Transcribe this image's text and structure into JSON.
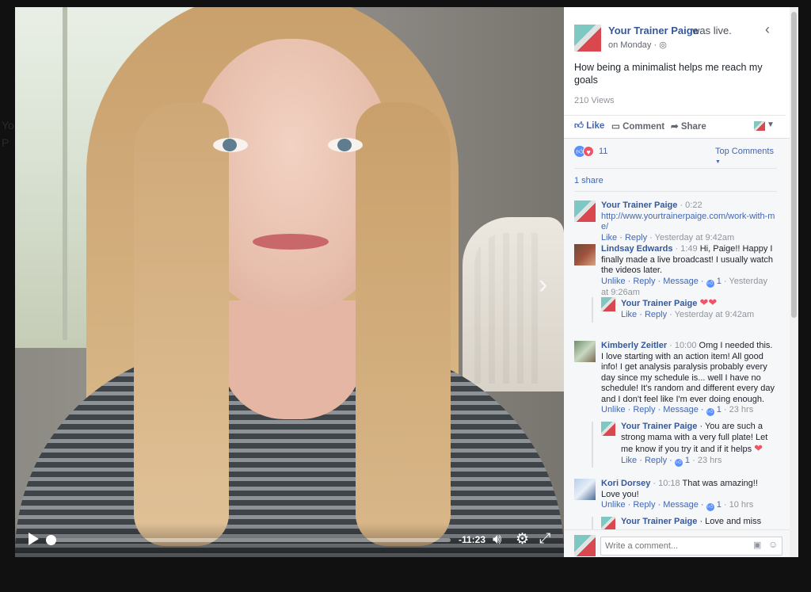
{
  "video": {
    "time_remaining": "-11:23",
    "progress": 0
  },
  "post": {
    "page_name": "Your Trainer Paige",
    "status_suffix": "was live.",
    "when": "on Monday · ",
    "caption": "How being a minimalist helps me reach my goals",
    "views": "210 Views"
  },
  "actions": {
    "like": "Like",
    "comment": "Comment",
    "share": "Share"
  },
  "reactions": {
    "count": "11",
    "sort_label": "Top Comments",
    "shares": "1 share"
  },
  "comments": [
    {
      "name": "Your Trainer Paige",
      "meta": " · 0:22",
      "text": "http://www.yourtrainerpaige.com/work-with-me/",
      "actions": "Like · Reply",
      "time": " · Yesterday at 9:42am"
    },
    {
      "name": "Lindsay Edwards",
      "meta": " · 1:49",
      "text": " Hi, Paige!! Happy I finally made a live broadcast! I usually watch the videos later.",
      "actions": "Unlike · Reply · Message · ",
      "likes": "1",
      "time": " · Yesterday at 9:26am",
      "reply": {
        "name": "Your Trainer Paige",
        "text": "",
        "actions": "Like · Reply",
        "time": " · Yesterday at 9:42am"
      }
    },
    {
      "name": "Kimberly Zeitler",
      "meta": " · 10:00",
      "text": " Omg I needed this. I love starting with an action item! All good info! I get analysis paralysis probably every day since my schedule is... well I have no schedule! It's random and different every day and I don't feel like I'm ever doing enough.",
      "actions": "Unlike · Reply · Message · ",
      "likes": "1",
      "time": " · 23 hrs",
      "reply": {
        "name": "Your Trainer Paige",
        "text": " · You are such a strong mama with a very full plate! Let me know if you try it and if it helps ",
        "actions": "Like · Reply · ",
        "likes": "1",
        "time": " · 23 hrs"
      }
    },
    {
      "name": "Kori Dorsey",
      "meta": " · 10:18",
      "text": " That was amazing!! Love you!",
      "actions": "Unlike · Reply · Message · ",
      "likes": "1",
      "time": " · 10 hrs",
      "reply": {
        "name": "Your Trainer Paige",
        "text": " · Love and miss you!!! ",
        "actions": "",
        "time": ""
      }
    }
  ],
  "composer": {
    "placeholder": "Write a comment..."
  },
  "colors": {
    "link": "#365899",
    "accent": "#4267b2",
    "heart": "#f25268"
  },
  "icons": [
    "play-icon",
    "volume-icon",
    "settings-icon",
    "fullscreen-icon",
    "next-arrow-icon",
    "back-chevron-icon",
    "globe-icon",
    "like-icon",
    "comment-icon",
    "share-icon",
    "camera-icon",
    "emoji-icon"
  ]
}
